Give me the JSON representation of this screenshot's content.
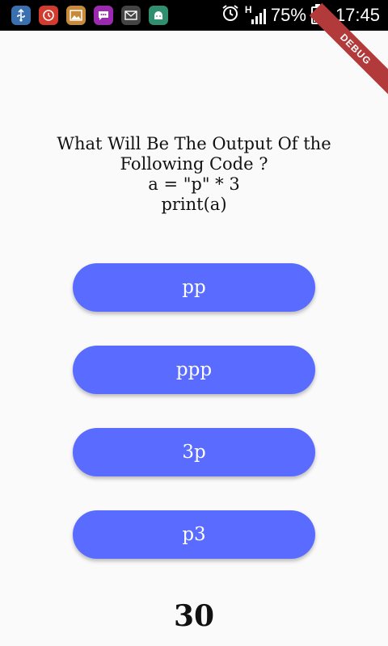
{
  "status_bar": {
    "battery_percent": "75%",
    "time": "17:45",
    "network": "H",
    "icons": [
      "usb-icon",
      "tv-icon",
      "gallery-icon",
      "messenger-icon",
      "gmail-icon",
      "android-icon",
      "alarm-icon"
    ]
  },
  "debug_banner": "DEBUG",
  "question": {
    "lines": [
      "What Will Be The Output Of the",
      "Following Code ?",
      "a = \"p\" * 3",
      "print(a)"
    ]
  },
  "options": [
    "pp",
    "ppp",
    "3p",
    "p3"
  ],
  "score": "30",
  "colors": {
    "button": "#5a6cff",
    "background": "#fafafa",
    "statusbar": "#000000",
    "ribbon": "#b23a3a"
  }
}
